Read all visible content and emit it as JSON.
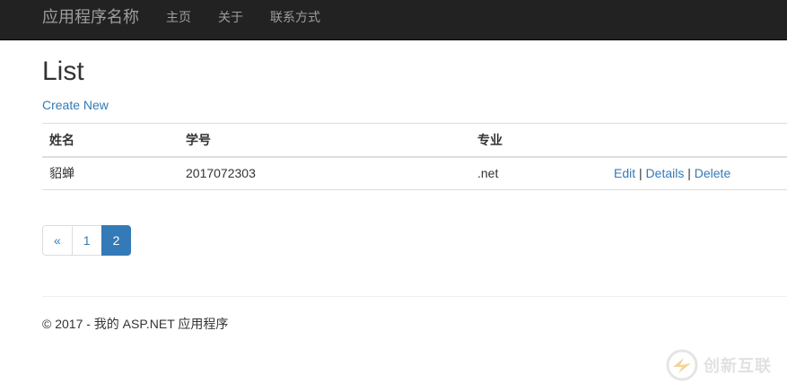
{
  "navbar": {
    "brand": "应用程序名称",
    "links": [
      "主页",
      "关于",
      "联系方式"
    ]
  },
  "page": {
    "title": "List",
    "create_link": "Create New"
  },
  "table": {
    "headers": [
      "姓名",
      "学号",
      "专业"
    ],
    "rows": [
      {
        "name": "貂蝉",
        "student_id": "2017072303",
        "major": ".net",
        "actions": [
          "Edit",
          "Details",
          "Delete"
        ],
        "separator": "|"
      }
    ]
  },
  "pagination": {
    "items": [
      "«",
      "1",
      "2"
    ],
    "active": "2"
  },
  "footer": {
    "text": "© 2017 - 我的 ASP.NET 应用程序"
  },
  "watermark": {
    "text": "创新互联"
  },
  "colors": {
    "navbar_bg": "#222222",
    "navbar_text": "#9d9d9d",
    "link": "#337ab7",
    "active_page_bg": "#337ab7"
  }
}
